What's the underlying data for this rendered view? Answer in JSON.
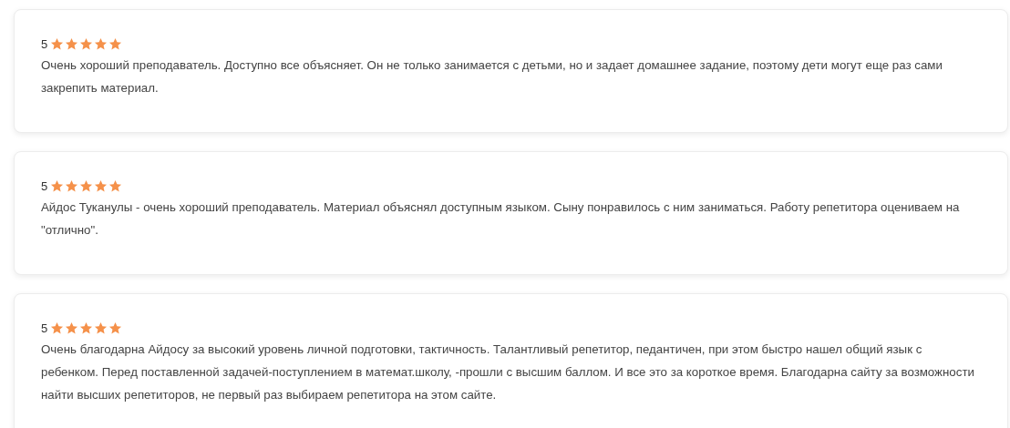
{
  "reviews": [
    {
      "rating": "5",
      "stars": 5,
      "text": "Очень хороший преподаватель. Доступно все объясняет. Он не только занимается с детьми, но и задает домашнее задание, поэтому дети могут еще раз сами закрепить материал."
    },
    {
      "rating": "5",
      "stars": 5,
      "text": "Айдос Туканулы - очень хороший преподаватель. Материал объяснял доступным языком. Сыну понравилось с ним заниматься. Работу репетитора оцениваем на \"отлично\"."
    },
    {
      "rating": "5",
      "stars": 5,
      "text": "Очень благодарна Айдосу за высокий уровень личной подготовки, тактичность. Талантливый репетитор, педантичен, при этом быстро нашел общий язык с ребенком. Перед поставленной задачей-поступлением в математ.школу, -прошли с высшим баллом. И все это за короткое время. Благодарна сайту за возможности найти высших репетиторов, не первый раз выбираем репетитора на этом сайте."
    }
  ]
}
